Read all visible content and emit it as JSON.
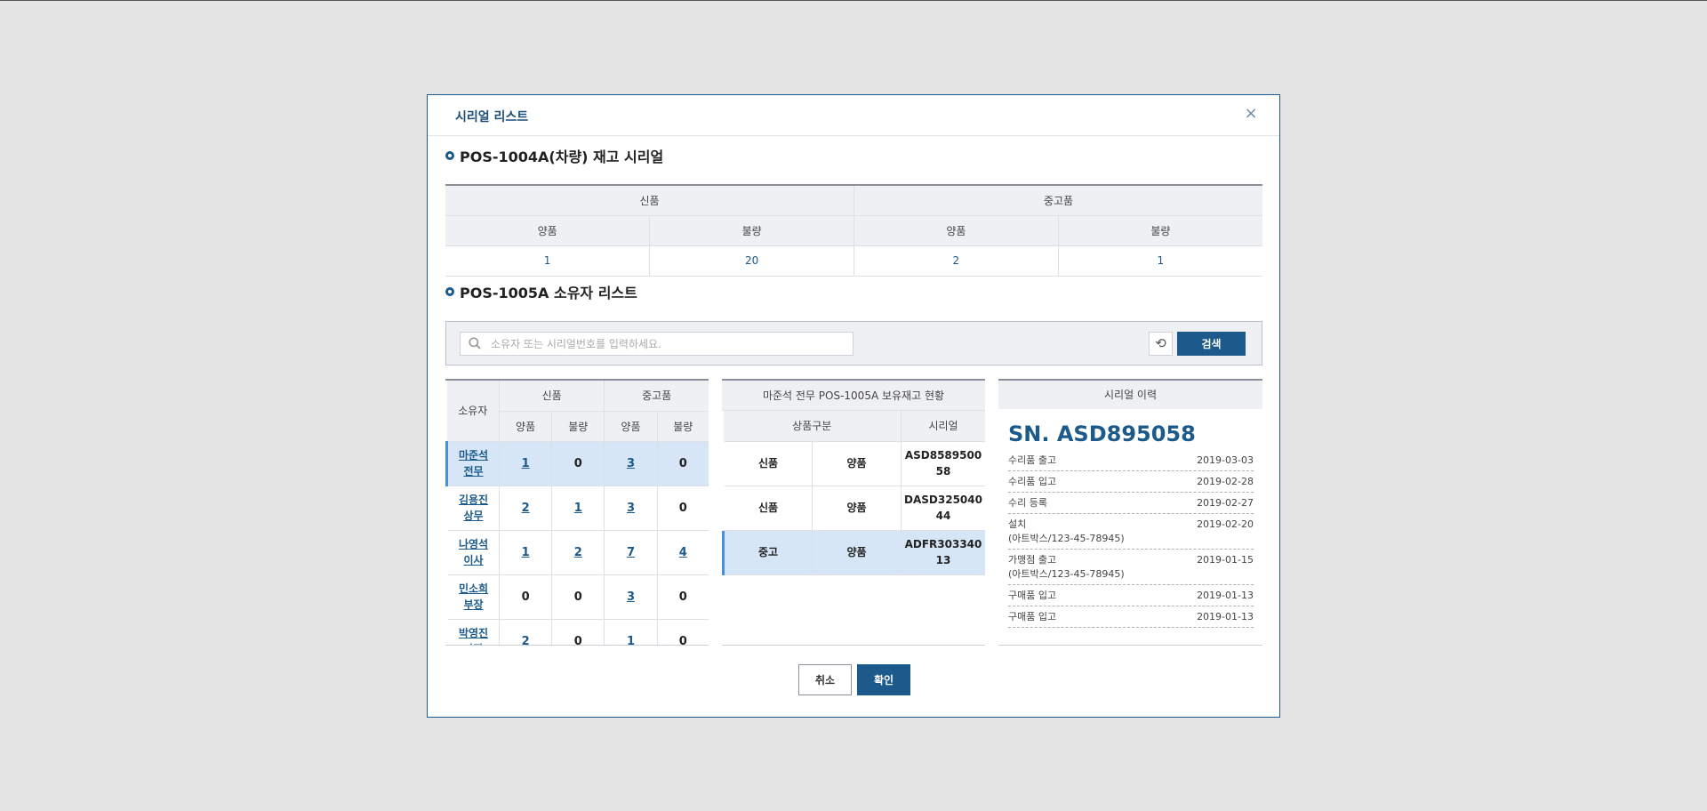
{
  "modal": {
    "title": "시리얼 리스트",
    "close_label": "×"
  },
  "stock_section": {
    "title": "POS-1004A(차량) 재고 시리얼",
    "groups": [
      "신품",
      "중고품"
    ],
    "sub_headers": [
      "양품",
      "불량",
      "양품",
      "불량"
    ],
    "values": [
      "1",
      "20",
      "2",
      "1"
    ]
  },
  "owner_section": {
    "title": "POS-1005A 소유자 리스트"
  },
  "search": {
    "placeholder": "소유자 또는 시리얼번호를 입력하세요.",
    "reset_label": "⟲",
    "button_label": "검색"
  },
  "owner_table": {
    "headers": {
      "owner": "소유자",
      "new": "신품",
      "used": "중고품",
      "good": "양품",
      "bad": "불량"
    },
    "rows": [
      {
        "name": "마준석",
        "title": "전무",
        "v": [
          "1",
          "0",
          "3",
          "0"
        ]
      },
      {
        "name": "김용진",
        "title": "상무",
        "v": [
          "2",
          "1",
          "3",
          "0"
        ]
      },
      {
        "name": "나영석",
        "title": "이사",
        "v": [
          "1",
          "2",
          "7",
          "4"
        ]
      },
      {
        "name": "민소희",
        "title": "부장",
        "v": [
          "0",
          "0",
          "3",
          "0"
        ]
      },
      {
        "name": "박영진",
        "title": "과장",
        "v": [
          "2",
          "0",
          "1",
          "0"
        ]
      }
    ]
  },
  "inventory": {
    "header": "마준석 전무 POS-1005A 보유재고 현황",
    "col_type": "상품구분",
    "col_serial": "시리얼",
    "rows": [
      {
        "type": "신품",
        "quality": "양품",
        "serial_a": "ASD8589500",
        "serial_b": "58"
      },
      {
        "type": "신품",
        "quality": "양품",
        "serial_a": "DASD325040",
        "serial_b": "44"
      },
      {
        "type": "중고",
        "quality": "양품",
        "serial_a": "ADFR303340",
        "serial_b": "13"
      }
    ]
  },
  "history": {
    "header": "시리얼 이력",
    "serial": "SN. ASD895058",
    "items": [
      {
        "label": "수리품 출고",
        "sub": "",
        "date": "2019-03-03"
      },
      {
        "label": "수리품 입고",
        "sub": "",
        "date": "2019-02-28"
      },
      {
        "label": "수리 등록",
        "sub": "",
        "date": "2019-02-27"
      },
      {
        "label": "설치",
        "sub": "(아트박스/123-45-78945)",
        "date": "2019-02-20"
      },
      {
        "label": "가맹점 출고",
        "sub": "(아트박스/123-45-78945)",
        "date": "2019-01-15"
      },
      {
        "label": "구매품 입고",
        "sub": "",
        "date": "2019-01-13"
      },
      {
        "label": "구매품 입고",
        "sub": "",
        "date": "2019-01-13"
      }
    ]
  },
  "footer": {
    "cancel_label": "취소",
    "ok_label": "확인"
  },
  "colors": {
    "accent": "#1b5a8a",
    "selected_row": "#d6e6f7",
    "selected_bar": "#4a90d9"
  }
}
